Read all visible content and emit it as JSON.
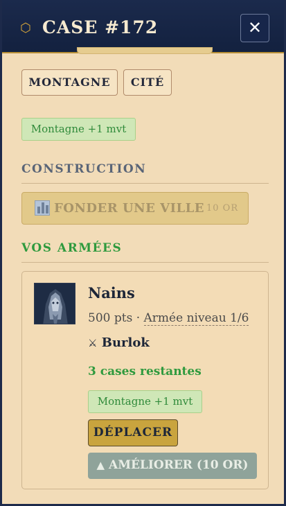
{
  "header": {
    "title": "CASE #172",
    "icon": "hexagon-icon",
    "close_label": "✕"
  },
  "terrain_tags": [
    "MONTAGNE",
    "CITÉ"
  ],
  "terrain_bonus": "Montagne +1 mvt",
  "construction": {
    "heading": "CONSTRUCTION",
    "found_city": {
      "label": "FONDER UNE VILLE",
      "cost": "10 OR",
      "enabled": false
    }
  },
  "armies": {
    "heading": "VOS ARMÉES",
    "items": [
      {
        "name": "Nains",
        "points": "500 pts",
        "separator": "·",
        "level": "Armée niveau 1/6",
        "commander_icon": "⚔",
        "commander": "Burlok",
        "remaining": "3 cases restantes",
        "bonus": "Montagne +1 mvt",
        "move_label": "DÉPLACER",
        "upgrade_icon": "▲",
        "upgrade_label": "AMÉLIORER (10 OR)"
      }
    ]
  },
  "colors": {
    "header_bg": "#1b2a4c",
    "panel_bg": "#f2dcb8",
    "accent_gold": "#c9a43e",
    "green": "#2f9a3e"
  }
}
